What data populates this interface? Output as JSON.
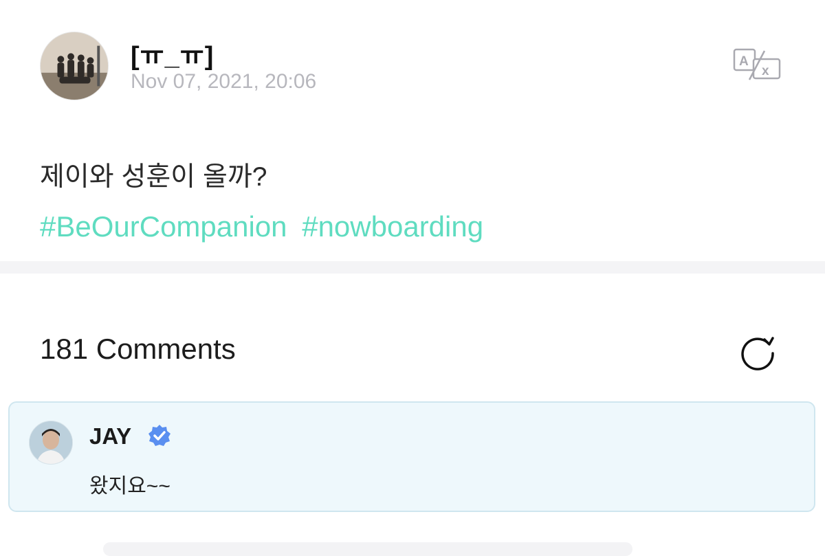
{
  "post": {
    "author": "[ㅠ_ㅠ]",
    "date": "Nov 07, 2021, 20:06",
    "text": "제이와 성훈이 올까?",
    "hashtags": [
      "#BeOurCompanion",
      "#nowboarding"
    ]
  },
  "comments": {
    "header": "181 Comments",
    "items": [
      {
        "author": "JAY",
        "verified": true,
        "text": "왔지요~~"
      }
    ]
  },
  "colors": {
    "hashtag": "#5fdcc0",
    "verified_badge": "#5a8ff0",
    "comment_bg": "#eef8fc"
  },
  "icons": {
    "translate": "translate-icon",
    "refresh": "refresh-icon",
    "verified": "verified-badge-icon"
  }
}
